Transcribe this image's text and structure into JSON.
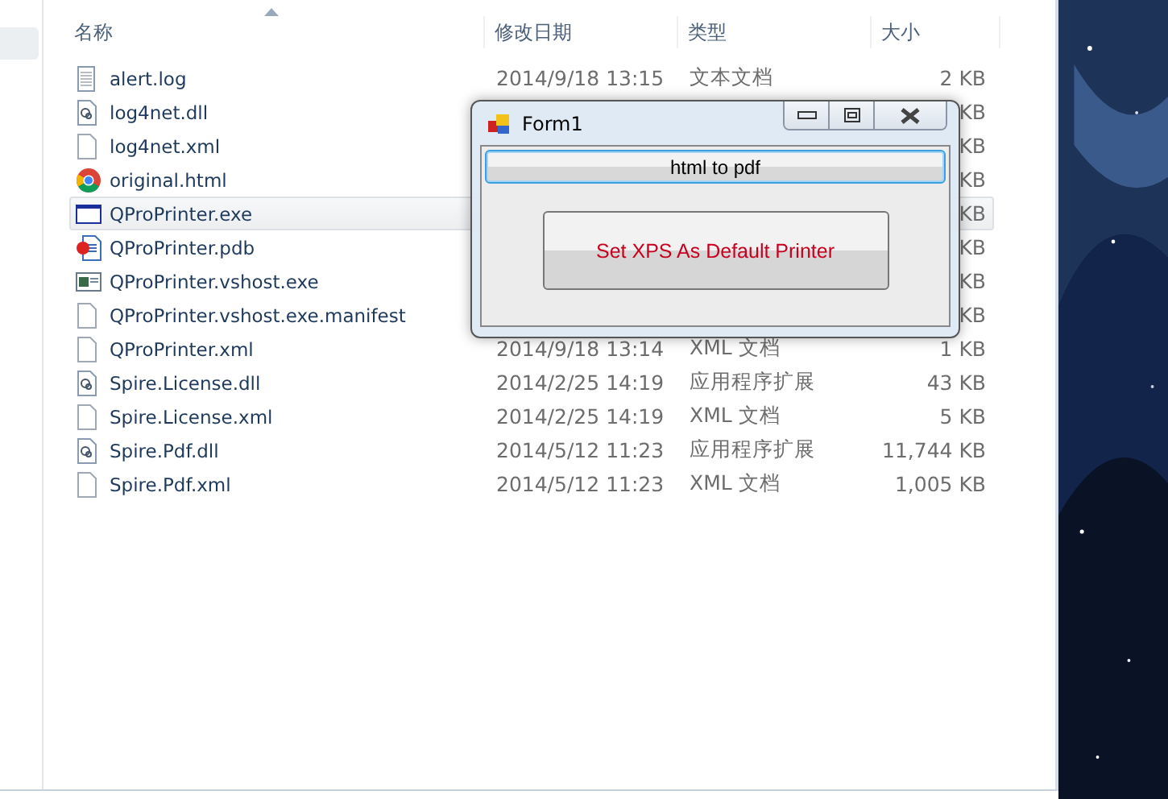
{
  "columns": [
    "名称",
    "修改日期",
    "类型",
    "大小"
  ],
  "files": [
    {
      "name": "alert.log",
      "kind": "text",
      "date": "2014/9/18 13:15",
      "type": "文本文档",
      "size": "2 KB",
      "selected": false
    },
    {
      "name": "log4net.dll",
      "kind": "library",
      "size": "KB",
      "selected": false
    },
    {
      "name": "log4net.xml",
      "kind": "file",
      "size": "KB",
      "selected": false
    },
    {
      "name": "original.html",
      "kind": "web",
      "size": "KB",
      "selected": false
    },
    {
      "name": "QProPrinter.exe",
      "kind": "program",
      "size": "KB",
      "selected": true
    },
    {
      "name": "QProPrinter.pdb",
      "kind": "debug",
      "size": "KB",
      "selected": false
    },
    {
      "name": "QProPrinter.vshost.exe",
      "kind": "app",
      "size": "KB",
      "selected": false
    },
    {
      "name": "QProPrinter.vshost.exe.manifest",
      "kind": "file",
      "size": "KB",
      "selected": false
    },
    {
      "name": "QProPrinter.xml",
      "kind": "file",
      "date": "2014/9/18 13:14",
      "type": "XML 文档",
      "size": "1 KB",
      "selected": false
    },
    {
      "name": "Spire.License.dll",
      "kind": "library",
      "date": "2014/2/25 14:19",
      "type": "应用程序扩展",
      "size": "43 KB",
      "selected": false
    },
    {
      "name": "Spire.License.xml",
      "kind": "file",
      "date": "2014/2/25 14:19",
      "type": "XML 文档",
      "size": "5 KB",
      "selected": false
    },
    {
      "name": "Spire.Pdf.dll",
      "kind": "library",
      "date": "2014/5/12 11:23",
      "type": "应用程序扩展",
      "size": "11,744 KB",
      "selected": false
    },
    {
      "name": "Spire.Pdf.xml",
      "kind": "file",
      "date": "2014/5/12 11:23",
      "type": "XML 文档",
      "size": "1,005 KB",
      "selected": false
    }
  ],
  "form": {
    "title": "Form1",
    "buttons": [
      {
        "label": "html to pdf",
        "kind": "focused"
      },
      {
        "label": "Set XPS As Default Printer",
        "kind": "warning"
      }
    ]
  }
}
